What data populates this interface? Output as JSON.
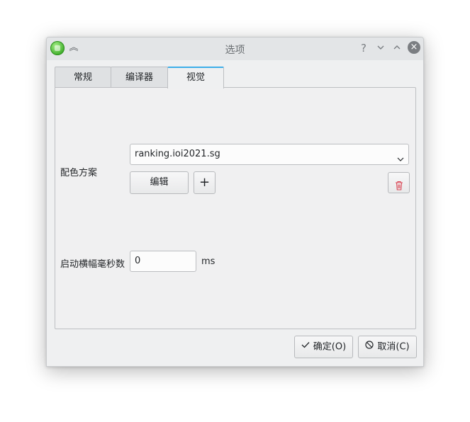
{
  "window": {
    "title": "选项",
    "help_glyph": "?",
    "minimize_glyph": "⌄",
    "maximize_glyph": "⌃",
    "close_glyph": "×",
    "keep_above_glyph": "︽"
  },
  "tabs": [
    {
      "label": "常规",
      "active": false
    },
    {
      "label": "编译器",
      "active": false
    },
    {
      "label": "视觉",
      "active": true
    }
  ],
  "visual": {
    "color_scheme_label": "配色方案",
    "color_scheme_value": "ranking.ioi2021.sg",
    "edit_label": "编辑",
    "add_glyph": "+",
    "splash_label": "启动横幅毫秒数",
    "splash_value": "0",
    "splash_unit": "ms"
  },
  "footer": {
    "ok_label": "确定(O)",
    "cancel_label": "取消(C)"
  },
  "colors": {
    "accent": "#3daee9",
    "danger": "#da4453",
    "window_bg": "#eff0f1"
  },
  "icons": [
    "app-icon",
    "keep-above-icon",
    "help-icon",
    "minimize-icon",
    "maximize-icon",
    "close-icon",
    "chevron-down-icon",
    "plus-icon",
    "trash-icon",
    "check-icon",
    "cancel-icon"
  ]
}
